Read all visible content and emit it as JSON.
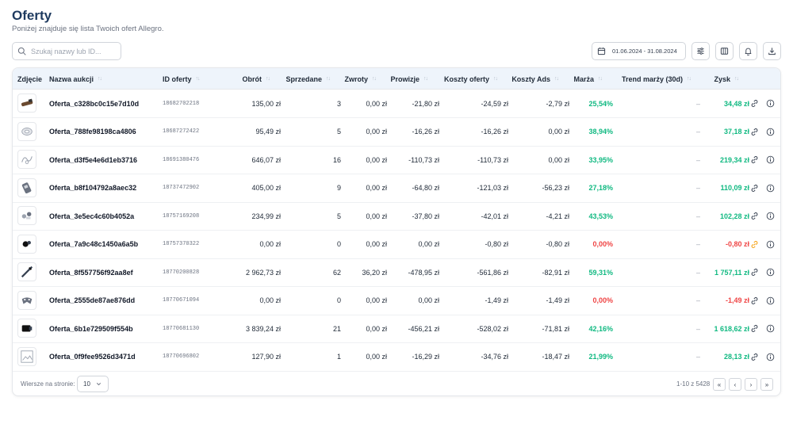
{
  "header": {
    "title": "Oferty",
    "subtitle": "Poniżej znajduje się lista Twoich ofert Allegro."
  },
  "search": {
    "placeholder": "Szukaj nazwy lub ID...",
    "value": ""
  },
  "toolbar": {
    "date_range": "01.06.2024 - 31.08.2024",
    "icons": [
      "calendar-icon",
      "filter-sliders-icon",
      "columns-icon",
      "bell-icon",
      "download-icon"
    ]
  },
  "table": {
    "columns": [
      "Zdjęcie",
      "Nazwa aukcji",
      "ID oferty",
      "Obrót",
      "Sprzedane",
      "Zwroty",
      "Prowizje",
      "Koszty oferty",
      "Koszty Ads",
      "Marża",
      "Trend marży (30d)",
      "Zysk"
    ],
    "rows": [
      {
        "thumb": "cable-icon",
        "name": "Oferta_c328bc0c15e7d10d",
        "id": "18682702218",
        "obrot": "135,00 zł",
        "sprzedane": "3",
        "zwroty": "0,00 zł",
        "prowizje": "-21,80 zł",
        "koszty": "-24,59 zł",
        "ads": "-2,79 zł",
        "marza": "25,54%",
        "trend": "–",
        "zysk": "34,48 zł",
        "status": "pos",
        "link_alert": false
      },
      {
        "thumb": "tape-icon",
        "name": "Oferta_788fe98198ca4806",
        "id": "18687272422",
        "obrot": "95,49 zł",
        "sprzedane": "5",
        "zwroty": "0,00 zł",
        "prowizje": "-16,26 zł",
        "koszty": "-16,26 zł",
        "ads": "0,00 zł",
        "marza": "38,94%",
        "trend": "–",
        "zysk": "37,18 zł",
        "status": "pos",
        "link_alert": false
      },
      {
        "thumb": "wire-icon",
        "name": "Oferta_d3f5e4e6d1eb3716",
        "id": "18691380476",
        "obrot": "646,07 zł",
        "sprzedane": "16",
        "zwroty": "0,00 zł",
        "prowizje": "-110,73 zł",
        "koszty": "-110,73 zł",
        "ads": "0,00 zł",
        "marza": "33,95%",
        "trend": "–",
        "zysk": "219,34 zł",
        "status": "pos",
        "link_alert": false
      },
      {
        "thumb": "device-icon",
        "name": "Oferta_b8f104792a8aec32",
        "id": "18737472902",
        "obrot": "405,00 zł",
        "sprzedane": "9",
        "zwroty": "0,00 zł",
        "prowizje": "-64,80 zł",
        "koszty": "-121,03 zł",
        "ads": "-56,23 zł",
        "marza": "27,18%",
        "trend": "–",
        "zysk": "110,09 zł",
        "status": "pos",
        "link_alert": false
      },
      {
        "thumb": "parts-icon",
        "name": "Oferta_3e5ec4c60b4052a",
        "id": "18757169208",
        "obrot": "234,99 zł",
        "sprzedane": "5",
        "zwroty": "0,00 zł",
        "prowizje": "-37,80 zł",
        "koszty": "-42,01 zł",
        "ads": "-4,21 zł",
        "marza": "43,53%",
        "trend": "–",
        "zysk": "102,28 zł",
        "status": "pos",
        "link_alert": false
      },
      {
        "thumb": "earbuds-icon",
        "name": "Oferta_7a9c48c1450a6a5b",
        "id": "18757370322",
        "obrot": "0,00 zł",
        "sprzedane": "0",
        "zwroty": "0,00 zł",
        "prowizje": "0,00 zł",
        "koszty": "-0,80 zł",
        "ads": "-0,80 zł",
        "marza": "0,00%",
        "trend": "–",
        "zysk": "-0,80 zł",
        "status": "neg",
        "link_alert": true
      },
      {
        "thumb": "stick-icon",
        "name": "Oferta_8f557756f92aa8ef",
        "id": "18770200828",
        "obrot": "2 962,73 zł",
        "sprzedane": "62",
        "zwroty": "36,20 zł",
        "prowizje": "-478,95 zł",
        "koszty": "-561,86 zł",
        "ads": "-82,91 zł",
        "marza": "59,31%",
        "trend": "–",
        "zysk": "1 757,11 zł",
        "status": "pos",
        "link_alert": false
      },
      {
        "thumb": "controller-icon",
        "name": "Oferta_2555de87ae876dd",
        "id": "18770671094",
        "obrot": "0,00 zł",
        "sprzedane": "0",
        "zwroty": "0,00 zł",
        "prowizje": "0,00 zł",
        "koszty": "-1,49 zł",
        "ads": "-1,49 zł",
        "marza": "0,00%",
        "trend": "–",
        "zysk": "-1,49 zł",
        "status": "neg",
        "link_alert": false
      },
      {
        "thumb": "box-icon",
        "name": "Oferta_6b1e729509f554b",
        "id": "18770681130",
        "obrot": "3 839,24 zł",
        "sprzedane": "21",
        "zwroty": "0,00 zł",
        "prowizje": "-456,21 zł",
        "koszty": "-528,02 zł",
        "ads": "-71,81 zł",
        "marza": "42,16%",
        "trend": "–",
        "zysk": "1 618,62 zł",
        "status": "pos",
        "link_alert": false
      },
      {
        "thumb": "broken-image-icon",
        "name": "Oferta_0f9fee9526d3471d",
        "id": "18770696802",
        "obrot": "127,90 zł",
        "sprzedane": "1",
        "zwroty": "0,00 zł",
        "prowizje": "-16,29 zł",
        "koszty": "-34,76 zł",
        "ads": "-18,47 zł",
        "marza": "21,99%",
        "trend": "–",
        "zysk": "28,13 zł",
        "status": "pos",
        "link_alert": false
      }
    ]
  },
  "pagination": {
    "rows_per_page_label": "Wiersze na stronie:",
    "rows_per_page": "10",
    "info": "1-10 z 5428",
    "buttons": [
      "«",
      "‹",
      "›",
      "»"
    ]
  },
  "colors": {
    "title": "#1e3a5f",
    "header_bg": "#eef4fb",
    "positive": "#10b981",
    "negative": "#ef4444",
    "link_alert": "#f59e0b"
  }
}
